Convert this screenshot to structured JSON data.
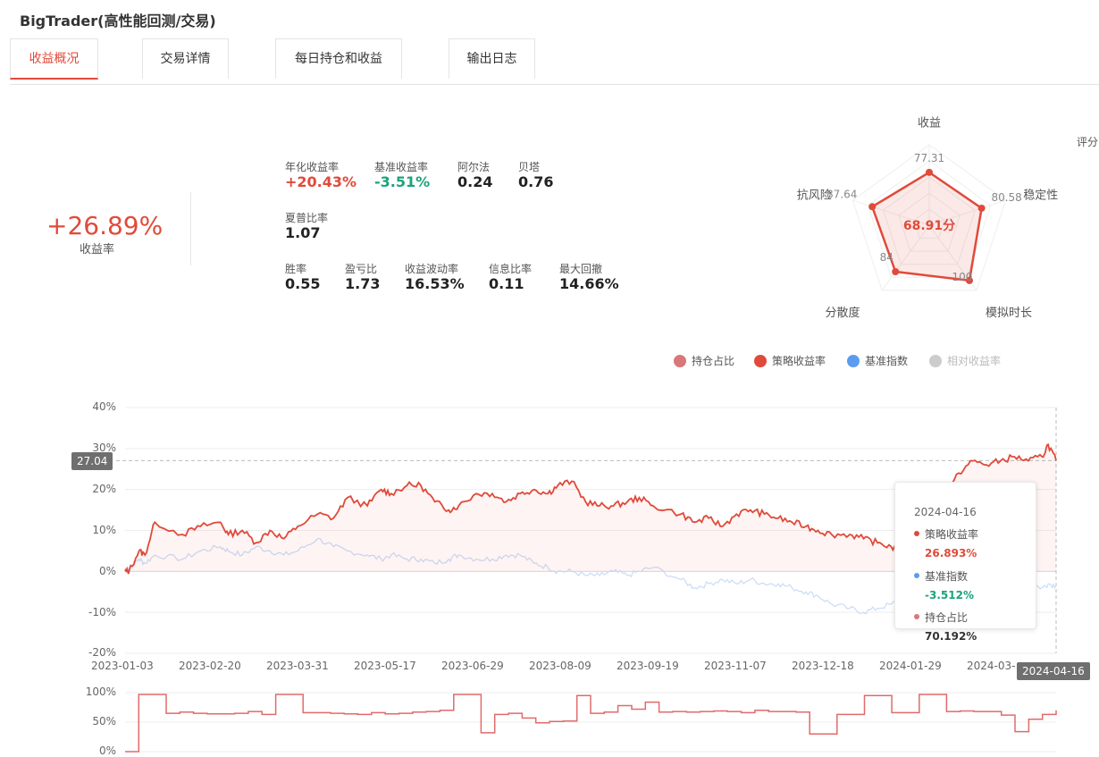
{
  "app": {
    "title": "BigTrader(高性能回测/交易)"
  },
  "tabs": [
    {
      "label": "收益概况"
    },
    {
      "label": "交易详情"
    },
    {
      "label": "每日持仓和收益"
    },
    {
      "label": "输出日志"
    }
  ],
  "summary": {
    "total_return": "+26.89%",
    "total_return_label": "收益率",
    "metrics": {
      "annual_return": {
        "label": "年化收益率",
        "value": "+20.43%"
      },
      "benchmark_return": {
        "label": "基准收益率",
        "value": "-3.51%"
      },
      "alpha": {
        "label": "阿尔法",
        "value": "0.24"
      },
      "beta": {
        "label": "贝塔",
        "value": "0.76"
      },
      "sharpe": {
        "label": "夏普比率",
        "value": "1.07"
      },
      "win_rate": {
        "label": "胜率",
        "value": "0.55"
      },
      "pl_ratio": {
        "label": "盈亏比",
        "value": "1.73"
      },
      "volatility": {
        "label": "收益波动率",
        "value": "16.53%"
      },
      "info_ratio": {
        "label": "信息比率",
        "value": "0.11"
      },
      "max_drawdown": {
        "label": "最大回撤",
        "value": "14.66%"
      }
    }
  },
  "radar": {
    "score_label": "评分",
    "center_score": "68.91分",
    "axes": [
      {
        "name": "收益",
        "value": 77.31,
        "label": "77.31"
      },
      {
        "name": "稳定性",
        "value": 80.58,
        "label": "80.58"
      },
      {
        "name": "模拟时长",
        "value": 100,
        "label": "100"
      },
      {
        "name": "分散度",
        "value": 84,
        "label": "84"
      },
      {
        "name": "抗风险",
        "value": 87.64,
        "label": "87.64"
      }
    ],
    "color": "#e04a3a"
  },
  "legend": [
    {
      "label": "持仓占比",
      "color": "#d9777a"
    },
    {
      "label": "策略收益率",
      "color": "#e04a3a"
    },
    {
      "label": "基准指数",
      "color": "#5b9cf0"
    },
    {
      "label": "相对收益率",
      "color": "#cccccc"
    }
  ],
  "crosshair": {
    "y_value": "27.04",
    "x_value": "2024-04-16"
  },
  "tooltip": {
    "date": "2024-04-16",
    "items": [
      {
        "name": "策略收益率",
        "value": "26.893%",
        "color": "#e04a3a"
      },
      {
        "name": "基准指数",
        "value": "-3.512%",
        "color": "#5b9cf0"
      },
      {
        "name": "持仓占比",
        "value": "70.192%",
        "color": "#d9777a"
      }
    ]
  },
  "chart_data": [
    {
      "type": "line",
      "ylim": [
        -20,
        40
      ],
      "y_ticks": [
        "40%",
        "30%",
        "20%",
        "10%",
        "0%",
        "-10%",
        "-20%"
      ],
      "x_ticks": [
        "2023-01-03",
        "2023-02-20",
        "2023-03-31",
        "2023-05-17",
        "2023-06-29",
        "2023-08-09",
        "2023-09-19",
        "2023-11-07",
        "2023-12-18",
        "2024-01-29",
        "2024-03-"
      ],
      "x": [
        "2023-01-03",
        "2023-01-05",
        "2023-01-10",
        "2023-01-13",
        "2023-01-18",
        "2023-02-01",
        "2023-02-10",
        "2023-02-20",
        "2023-02-24",
        "2023-03-03",
        "2023-03-10",
        "2023-03-17",
        "2023-03-24",
        "2023-03-31",
        "2023-04-10",
        "2023-04-18",
        "2023-04-25",
        "2023-05-05",
        "2023-05-12",
        "2023-05-17",
        "2023-05-25",
        "2023-06-01",
        "2023-06-08",
        "2023-06-15",
        "2023-06-20",
        "2023-06-29",
        "2023-07-07",
        "2023-07-14",
        "2023-07-21",
        "2023-07-28",
        "2023-08-04",
        "2023-08-09",
        "2023-08-16",
        "2023-08-23",
        "2023-08-30",
        "2023-09-06",
        "2023-09-13",
        "2023-09-19",
        "2023-09-26",
        "2023-10-10",
        "2023-10-17",
        "2023-10-24",
        "2023-10-31",
        "2023-11-07",
        "2023-11-14",
        "2023-11-21",
        "2023-11-28",
        "2023-12-05",
        "2023-12-12",
        "2023-12-18",
        "2023-12-25",
        "2024-01-03",
        "2024-01-10",
        "2024-01-17",
        "2024-01-24",
        "2024-01-29",
        "2024-02-05",
        "2024-02-20",
        "2024-02-27",
        "2024-03-05",
        "2024-03-12",
        "2024-03-19",
        "2024-03-26",
        "2024-04-02",
        "2024-04-09",
        "2024-04-12",
        "2024-04-16"
      ],
      "series": [
        {
          "name": "策略收益率",
          "color": "#e04a3a",
          "values": [
            0,
            0,
            5,
            4,
            12,
            9,
            11,
            12,
            9,
            10,
            7,
            10,
            8,
            11,
            14,
            13,
            18,
            16,
            20,
            19,
            21,
            21,
            17,
            15,
            16,
            19,
            19,
            17,
            19,
            20,
            19,
            21,
            22,
            17,
            16,
            16,
            17,
            18,
            16,
            14,
            12,
            13,
            11,
            14,
            15,
            14,
            13,
            12,
            11,
            10,
            9,
            9,
            8,
            7,
            6,
            5,
            10,
            18,
            24,
            27,
            26,
            27,
            28,
            27,
            28,
            31,
            27.04
          ]
        },
        {
          "name": "基准指数",
          "color": "#5b9cf0",
          "values": [
            0,
            1,
            3,
            2,
            4,
            3,
            5,
            6,
            5,
            4,
            6,
            5,
            4,
            5,
            8,
            6,
            5,
            4,
            3,
            4,
            3,
            3,
            2,
            3,
            4,
            3,
            3,
            4,
            4,
            2,
            1,
            0,
            0,
            -1,
            -1,
            0,
            -1,
            0,
            1,
            -2,
            -4,
            -3,
            -2,
            -3,
            -2,
            -3,
            -3,
            -4,
            -5,
            -6,
            -8,
            -9,
            -10,
            -9,
            -8,
            -7,
            -5,
            -4,
            -3,
            -4,
            -3,
            -3,
            -4,
            -3,
            -4,
            -3,
            -3.51
          ]
        }
      ]
    },
    {
      "type": "line",
      "ylim": [
        0,
        100
      ],
      "y_ticks": [
        "100%",
        "50%",
        "0%"
      ],
      "series": [
        {
          "name": "持仓占比",
          "color": "#e06b6b",
          "values": [
            0,
            97,
            97,
            65,
            67,
            65,
            64,
            64,
            65,
            68,
            63,
            97,
            97,
            66,
            66,
            65,
            64,
            63,
            66,
            64,
            65,
            67,
            68,
            70,
            97,
            97,
            32,
            63,
            65,
            57,
            49,
            51,
            52,
            95,
            65,
            67,
            78,
            72,
            84,
            67,
            68,
            67,
            68,
            69,
            68,
            66,
            70,
            68,
            68,
            67,
            30,
            30,
            63,
            63,
            95,
            95,
            66,
            66,
            97,
            97,
            68,
            69,
            68,
            68,
            62,
            34,
            55,
            63,
            70
          ]
        }
      ]
    }
  ]
}
